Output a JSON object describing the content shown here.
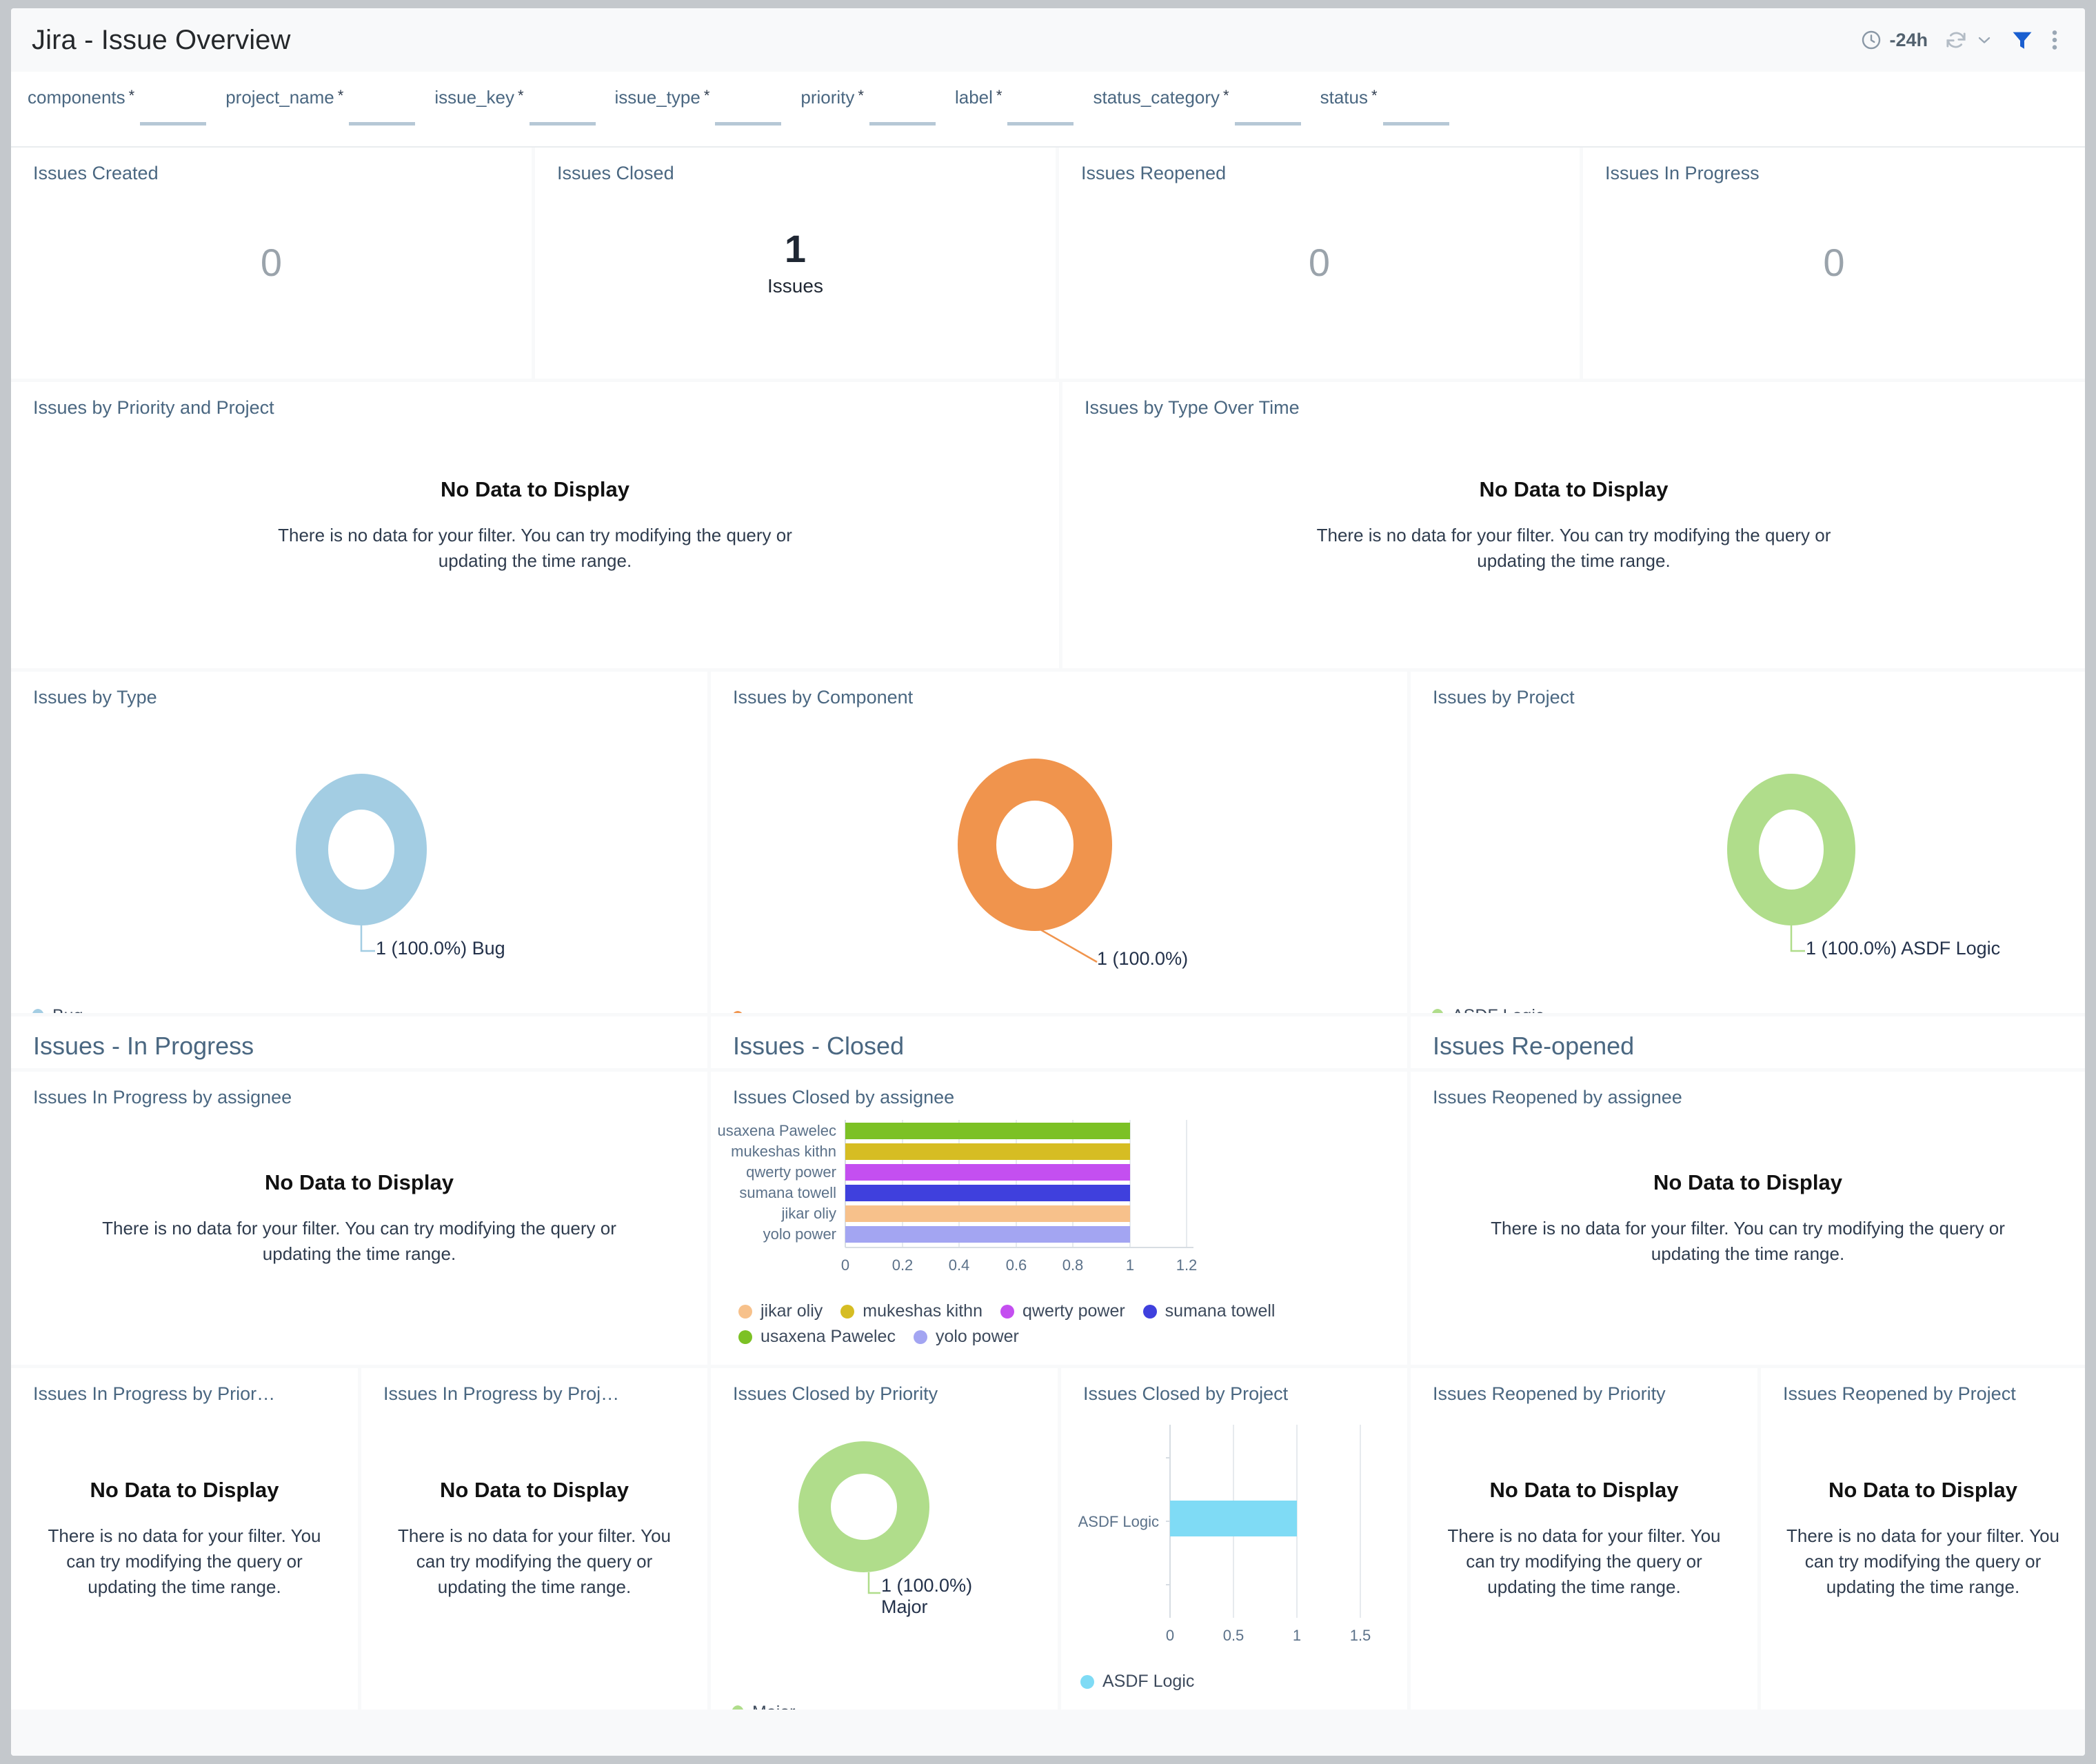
{
  "header": {
    "title": "Jira - Issue Overview",
    "time_range": "-24h",
    "icons": {
      "clock": "clock-icon",
      "refresh": "refresh-icon",
      "chevron": "chevron-down-icon",
      "filter": "filter-icon",
      "more": "more-vertical-icon"
    }
  },
  "filters": [
    {
      "label": "components",
      "required": "*",
      "value": ""
    },
    {
      "label": "project_name",
      "required": "*",
      "value": ""
    },
    {
      "label": "issue_key",
      "required": "*",
      "value": ""
    },
    {
      "label": "issue_type",
      "required": "*",
      "value": ""
    },
    {
      "label": "priority",
      "required": "*",
      "value": ""
    },
    {
      "label": "label",
      "required": "*",
      "value": ""
    },
    {
      "label": "status_category",
      "required": "*",
      "value": ""
    },
    {
      "label": "status",
      "required": "*",
      "value": ""
    }
  ],
  "kpis": [
    {
      "title": "Issues Created",
      "value": "0",
      "unit": "",
      "highlight": false
    },
    {
      "title": "Issues Closed",
      "value": "1",
      "unit": "Issues",
      "highlight": true
    },
    {
      "title": "Issues Reopened",
      "value": "0",
      "unit": "",
      "highlight": false
    },
    {
      "title": "Issues In Progress",
      "value": "0",
      "unit": "",
      "highlight": false
    }
  ],
  "nodata": {
    "title": "No Data to Display",
    "message": "There is no data for your filter. You can try modifying the query or updating the time range."
  },
  "panels": {
    "priority_project": "Issues by Priority and Project",
    "type_over_time": "Issues by Type Over Time",
    "issues_by_type": "Issues by Type",
    "issues_by_component": "Issues by Component",
    "issues_by_project": "Issues by Project",
    "inprogress_assignee": "Issues In Progress by assignee",
    "closed_assignee": "Issues Closed by assignee",
    "reopened_assignee": "Issues Reopened by assignee",
    "inprogress_priority": "Issues In Progress by Prior…",
    "inprogress_project": "Issues In Progress by Proj…",
    "closed_priority": "Issues Closed by Priority",
    "closed_project": "Issues Closed by Project",
    "reopened_priority": "Issues Reopened by Priority",
    "reopened_project": "Issues Reopened by Project"
  },
  "sections": {
    "in_progress": "Issues - In Progress",
    "closed": "Issues - Closed",
    "reopened": "Issues Re-opened"
  },
  "colors": {
    "accent": "#1a73e8",
    "title": "#4a6781",
    "bug": "#a3cde3",
    "component": "#f0944d",
    "project_green": "#b0dd8b",
    "closed_project_blue": "#7fdbf5"
  },
  "chart_data": [
    {
      "id": "issues_by_type",
      "type": "pie",
      "title": "Issues by Type",
      "labels": [
        "Bug"
      ],
      "values": [
        1
      ],
      "percents": [
        "100.0%"
      ],
      "data_label": "1 (100.0%) Bug",
      "legend": [
        {
          "name": "Bug",
          "color": "#a3cde3"
        }
      ],
      "legend_position": "bottom-left",
      "donut": true
    },
    {
      "id": "issues_by_component",
      "type": "pie",
      "title": "Issues by Component",
      "labels": [
        ""
      ],
      "values": [
        1
      ],
      "percents": [
        "100.0%"
      ],
      "data_label": "1 (100.0%)",
      "legend": [
        {
          "name": "",
          "color": "#f0944d"
        }
      ],
      "legend_position": "bottom-left",
      "donut": true
    },
    {
      "id": "issues_by_project",
      "type": "pie",
      "title": "Issues by Project",
      "labels": [
        "ASDF Logic"
      ],
      "values": [
        1
      ],
      "percents": [
        "100.0%"
      ],
      "data_label": "1 (100.0%) ASDF Logic",
      "legend": [
        {
          "name": "ASDF Logic",
          "color": "#b0dd8b"
        }
      ],
      "legend_position": "bottom-left",
      "donut": true
    },
    {
      "id": "issues_closed_by_assignee",
      "type": "bar",
      "orientation": "horizontal",
      "title": "Issues Closed by assignee",
      "categories": [
        "usaxena Pawelec",
        "mukeshas kithn",
        "qwerty power",
        "sumana towell",
        "jikar oliy",
        "yolo power"
      ],
      "values": [
        1,
        1,
        1,
        1,
        1,
        1
      ],
      "bar_colors": [
        "#7cc125",
        "#d6bd23",
        "#c44ff0",
        "#3f40dd",
        "#f7c18b",
        "#a3a5f2"
      ],
      "xlabel": "",
      "ylabel": "",
      "xticks": [
        "0",
        "0.2",
        "0.4",
        "0.6",
        "0.8",
        "1",
        "1.2"
      ],
      "xlim": [
        0,
        1.2
      ],
      "grid": true,
      "legend": [
        {
          "name": "jikar oliy",
          "color": "#f7c18b"
        },
        {
          "name": "mukeshas kithn",
          "color": "#d6bd23"
        },
        {
          "name": "qwerty power",
          "color": "#c44ff0"
        },
        {
          "name": "sumana towell",
          "color": "#3f40dd"
        },
        {
          "name": "usaxena Pawelec",
          "color": "#7cc125"
        },
        {
          "name": "yolo power",
          "color": "#a3a5f2"
        }
      ],
      "legend_position": "bottom"
    },
    {
      "id": "issues_closed_by_priority",
      "type": "pie",
      "title": "Issues Closed by Priority",
      "labels": [
        "Major"
      ],
      "values": [
        1
      ],
      "percents": [
        "100.0%"
      ],
      "data_label_line1": "1 (100.0%)",
      "data_label_line2": "Major",
      "legend": [
        {
          "name": "Major",
          "color": "#b0dd8b"
        }
      ],
      "legend_position": "bottom-left",
      "donut": true
    },
    {
      "id": "issues_closed_by_project",
      "type": "bar",
      "orientation": "horizontal",
      "title": "Issues Closed by Project",
      "categories": [
        "ASDF Logic"
      ],
      "values": [
        1
      ],
      "bar_colors": [
        "#7fdbf5"
      ],
      "xticks": [
        "0",
        "0.5",
        "1",
        "1.5"
      ],
      "xlim": [
        0,
        1.5
      ],
      "grid": true,
      "legend": [
        {
          "name": "ASDF Logic",
          "color": "#7fdbf5"
        }
      ],
      "legend_position": "bottom"
    }
  ]
}
